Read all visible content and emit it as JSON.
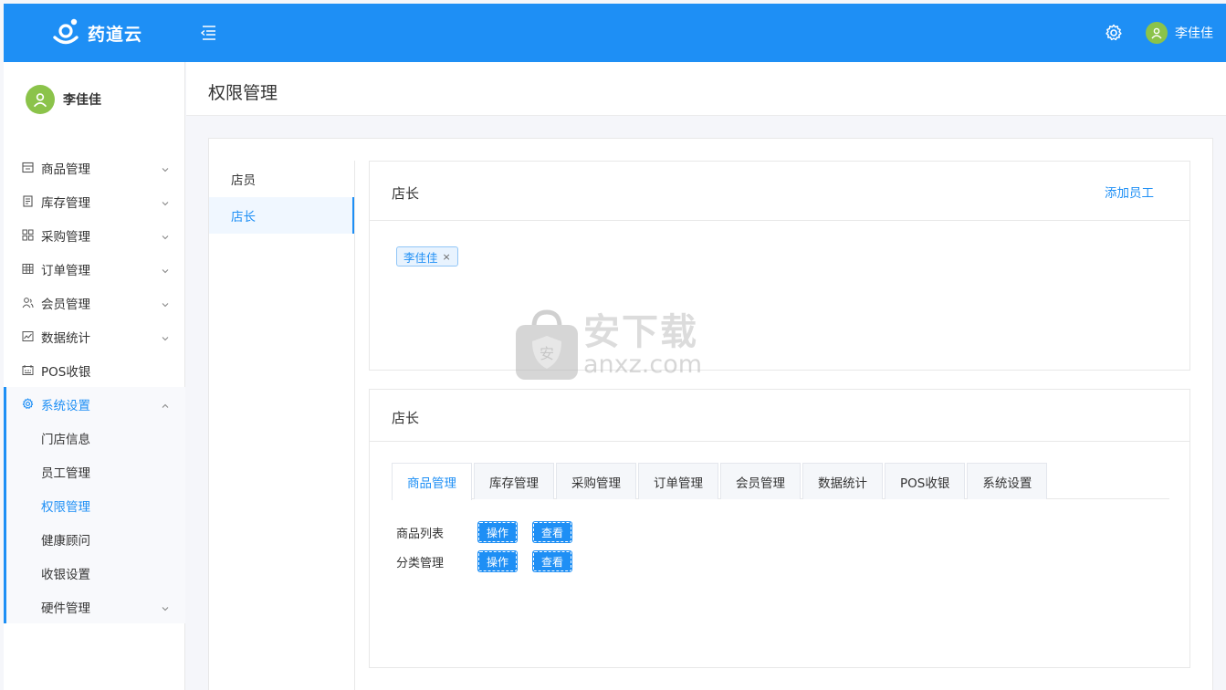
{
  "app": {
    "brand_name": "药道云",
    "brand_color": "#1e8ff5"
  },
  "header": {
    "user_name": "李佳佳"
  },
  "sidebar": {
    "user_name": "李佳佳",
    "items": [
      {
        "label": "商品管理",
        "icon": "shop-icon"
      },
      {
        "label": "库存管理",
        "icon": "inventory-icon"
      },
      {
        "label": "采购管理",
        "icon": "grid-icon"
      },
      {
        "label": "订单管理",
        "icon": "table-icon"
      },
      {
        "label": "会员管理",
        "icon": "members-icon"
      },
      {
        "label": "数据统计",
        "icon": "chart-icon"
      },
      {
        "label": "POS收银",
        "icon": "pos-icon"
      },
      {
        "label": "系统设置",
        "icon": "settings-icon"
      }
    ],
    "sub_items": [
      {
        "label": "门店信息"
      },
      {
        "label": "员工管理"
      },
      {
        "label": "权限管理"
      },
      {
        "label": "健康顾问"
      },
      {
        "label": "收银设置"
      },
      {
        "label": "硬件管理"
      }
    ]
  },
  "page": {
    "title": "权限管理"
  },
  "roles": [
    {
      "label": "店员"
    },
    {
      "label": "店长"
    }
  ],
  "staff_card": {
    "title": "店长",
    "add_label": "添加员工",
    "tags": [
      {
        "label": "李佳佳",
        "close": "×"
      }
    ]
  },
  "perm_card": {
    "title": "店长",
    "tabs": [
      {
        "label": "商品管理"
      },
      {
        "label": "库存管理"
      },
      {
        "label": "采购管理"
      },
      {
        "label": "订单管理"
      },
      {
        "label": "会员管理"
      },
      {
        "label": "数据统计"
      },
      {
        "label": "POS收银"
      },
      {
        "label": "系统设置"
      }
    ],
    "rows": [
      {
        "label": "商品列表",
        "op": "操作",
        "view": "查看"
      },
      {
        "label": "分类管理",
        "op": "操作",
        "view": "查看"
      }
    ]
  },
  "watermark": {
    "cn": "安下载",
    "en": "anxz.com"
  }
}
